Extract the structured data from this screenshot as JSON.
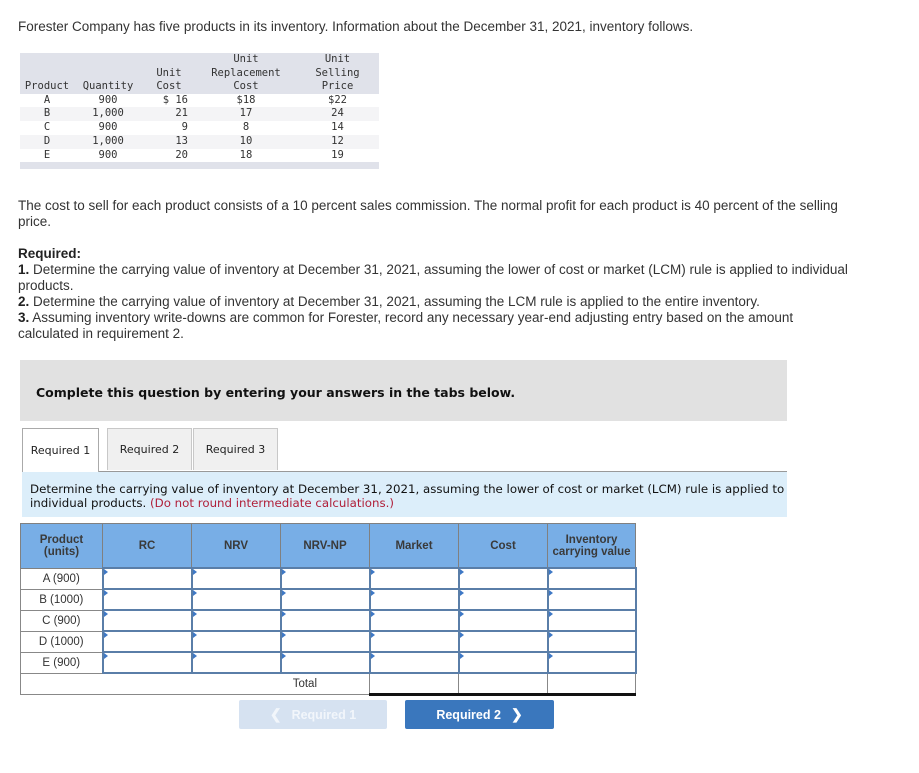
{
  "intro": "Forester Company has five products in its inventory. Information about the December 31, 2021, inventory follows.",
  "inventory_table": {
    "headers": [
      [
        "",
        "",
        "Product"
      ],
      [
        "",
        "",
        "Quantity"
      ],
      [
        "",
        "Unit",
        "Cost"
      ],
      [
        "Unit",
        "Replacement",
        "Cost"
      ],
      [
        "Unit",
        "Selling",
        "Price"
      ]
    ],
    "rows": [
      [
        "A",
        "900",
        "$ 16",
        "$18",
        "$22"
      ],
      [
        "B",
        "1,000",
        "21",
        "17",
        "24"
      ],
      [
        "C",
        "900",
        "9",
        "8",
        "14"
      ],
      [
        "D",
        "1,000",
        "13",
        "10",
        "12"
      ],
      [
        "E",
        "900",
        "20",
        "18",
        "19"
      ]
    ]
  },
  "cost_paragraph": "The cost to sell for each product consists of a 10 percent sales commission. The normal profit for each product is 40 percent of the selling price.",
  "required": {
    "heading": "Required:",
    "items": [
      {
        "num": "1.",
        "text": " Determine the carrying value of inventory at December 31, 2021, assuming the lower of cost or market (LCM) rule is applied to individual products."
      },
      {
        "num": "2.",
        "text": " Determine the carrying value of inventory at December 31, 2021, assuming the LCM rule is applied to the entire inventory."
      },
      {
        "num": "3.",
        "text": " Assuming inventory write-downs are common for Forester, record any necessary year-end adjusting entry based on the amount calculated in requirement 2."
      }
    ]
  },
  "complete_prompt": "Complete this question by entering your answers in the tabs below.",
  "tabs": [
    {
      "label": "Required 1",
      "active": true
    },
    {
      "label": "Required 2",
      "active": false
    },
    {
      "label": "Required 3",
      "active": false
    }
  ],
  "instruction": {
    "text": "Determine the carrying value of inventory at December 31, 2021, assuming the lower of cost or market (LCM) rule is applied to individual products.",
    "note": "(Do not round intermediate calculations.)"
  },
  "answer_table": {
    "columns": [
      "Product (units)",
      "RC",
      "NRV",
      "NRV-NP",
      "Market",
      "Cost",
      "Inventory carrying value"
    ],
    "rows": [
      "A (900)",
      "B (1000)",
      "C (900)",
      "D (1000)",
      "E (900)"
    ],
    "total_label": "Total"
  },
  "nav": {
    "prev_label": "Required 1",
    "next_label": "Required 2",
    "prev_icon": "chevron-left-icon",
    "next_icon": "chevron-right-icon"
  },
  "colors": {
    "header_blue": "#78aee6",
    "button_blue": "#3a77bd",
    "note_red": "#b0203a",
    "instruction_bg": "#dceefa"
  }
}
